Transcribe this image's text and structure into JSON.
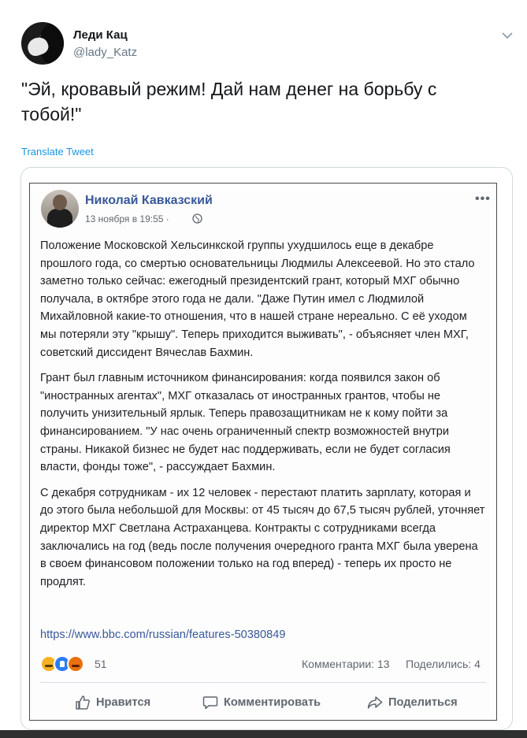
{
  "tweet": {
    "author_name": "Леди Кац",
    "author_handle": "@lady_Katz",
    "text": "\"Эй, кровавый режим! Дай нам денег на борьбу с тобой!\"",
    "translate_label": "Translate Tweet"
  },
  "fb_post": {
    "author_name": "Николай Кавказский",
    "date": "13 ноября в 19:55 ·",
    "more_label": "•••",
    "paragraphs": [
      "Положение Московской Хельсинкской группы ухудшилось еще в декабре прошлого года, со смертью основательницы Людмилы Алексеевой. Но это стало заметно только сейчас: ежегодный президентский грант, который МХГ обычно получала, в октябре этого года не дали. \"Даже Путин имел с Людмилой Михайловной какие-то отношения, что в нашей стране нереально. С её уходом мы потеряли эту \"крышу\". Теперь приходится выживать\", - объясняет член МХГ, советский диссидент Вячеслав Бахмин.",
      "Грант был главным источником финансирования: когда появился закон об \"иностранных агентах\", МХГ отказалась от иностранных грантов, чтобы не получить унизительный ярлык. Теперь правозащитникам не к кому пойти за финансированием. \"У нас очень ограниченный спектр возможностей внутри страны. Никакой бизнес не будет нас поддерживать, если не будет согласия власти, фонды тоже\", - рассуждает Бахмин.",
      "С декабря сотрудникам - их 12 человек - перестают платить зарплату, которая и до этого была небольшой для Москвы: от 45 тысяч до 67,5 тысяч рублей, уточняет директор МХГ Светлана Астраханцева. Контракты с сотрудниками всегда заключались на год (ведь после получения очередного гранта МХГ была уверена в своем финансовом положении только на год вперед) - теперь их просто не продлят."
    ],
    "link": "https://www.bbc.com/russian/features-50380849",
    "reactions_count": "51",
    "comments": "Комментарии: 13",
    "shares": "Поделились: 4",
    "actions": {
      "like": "Нравится",
      "comment": "Комментировать",
      "share": "Поделиться"
    }
  },
  "colors": {
    "twitter_link": "#1b95e0",
    "fb_blue": "#385898",
    "muted": "#606770"
  }
}
